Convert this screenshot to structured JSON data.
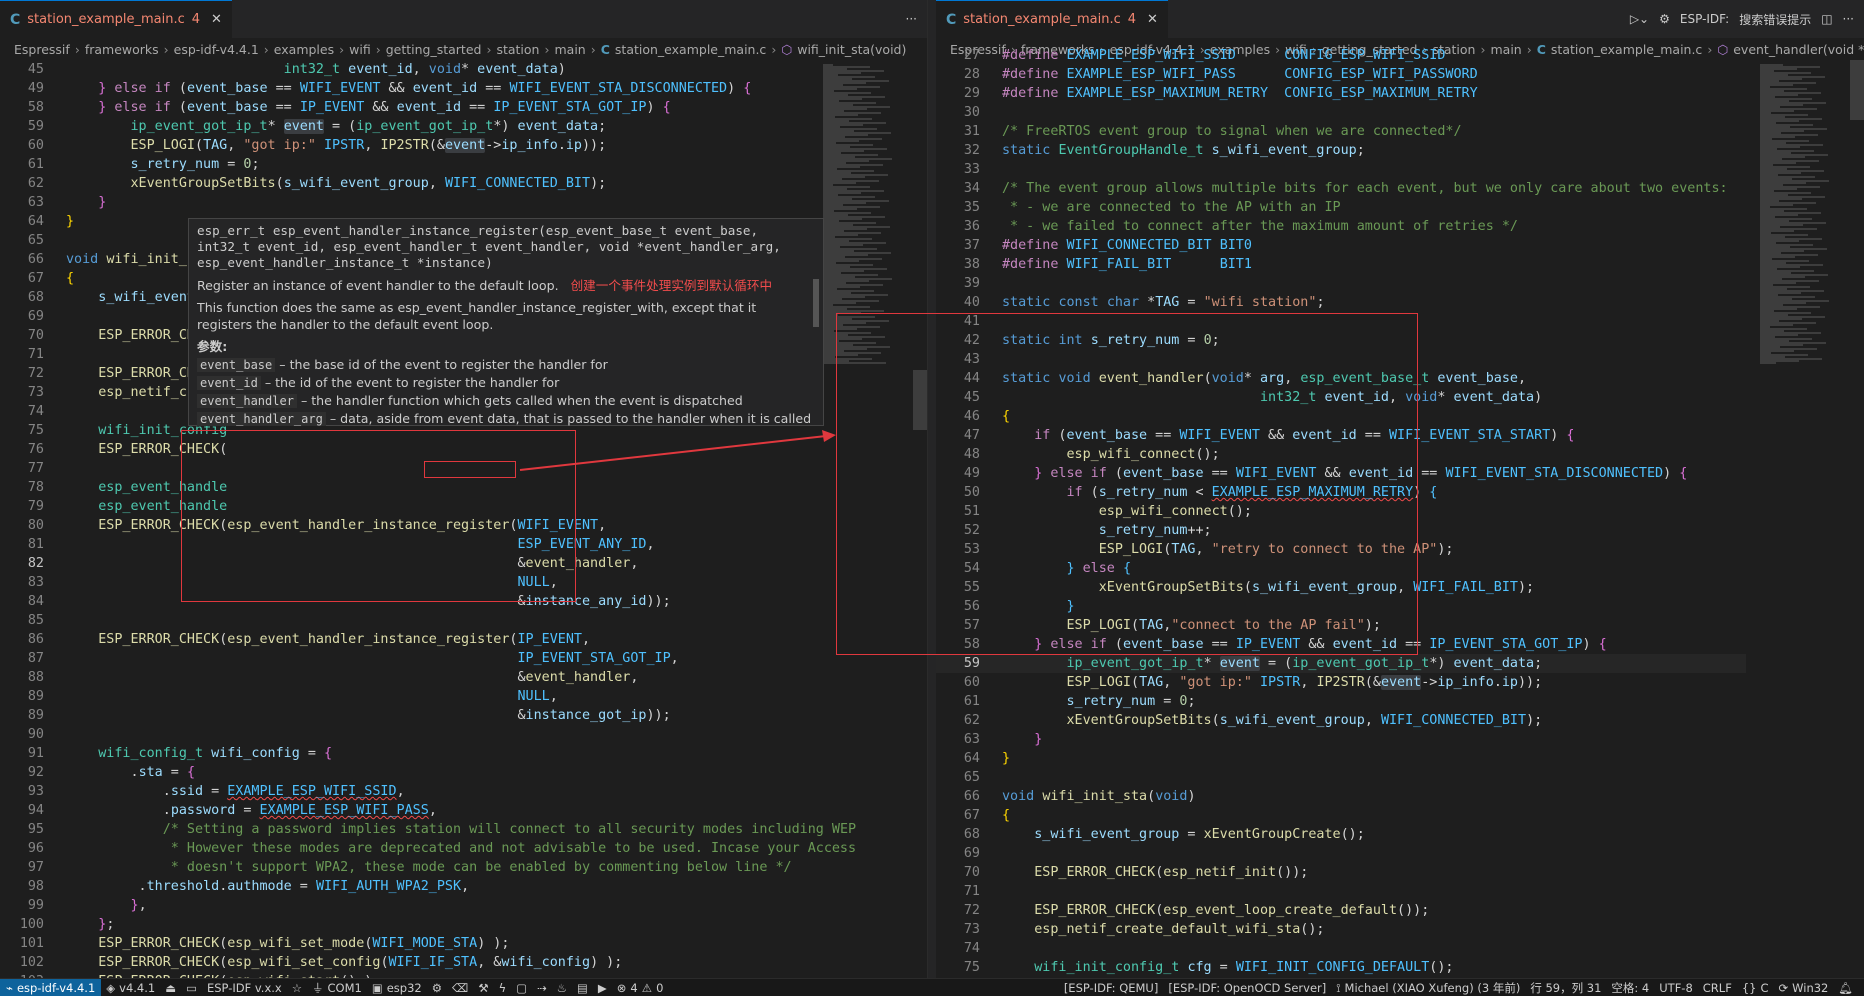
{
  "left": {
    "tab": {
      "name": "station_example_main.c",
      "problems": "4"
    },
    "breadcrumb": [
      "Espressif",
      "frameworks",
      "esp-idf-v4.4.1",
      "examples",
      "wifi",
      "getting_started",
      "station",
      "main",
      "station_example_main.c",
      "wifi_init_sta(void)"
    ],
    "hover": {
      "signature": "esp_err_t esp_event_handler_instance_register(esp_event_base_t event_base, int32_t event_id, esp_event_handler_t event_handler, void *event_handler_arg, esp_event_handler_instance_t *instance)",
      "summary": "Register an instance of event handler to the default loop.",
      "annotation": "创建一个事件处理实例到默认循环中",
      "description": "This function does the same as esp_event_handler_instance_register_with, except that it registers the handler to the default event loop.",
      "params_title": "参数:",
      "params": [
        {
          "name": "event_base",
          "desc": "– the base id of the event to register the handler for"
        },
        {
          "name": "event_id",
          "desc": "– the id of the event to register the handler for"
        },
        {
          "name": "event_handler",
          "desc": "– the handler function which gets called when the event is dispatched"
        },
        {
          "name": "event_handler_arg",
          "desc": "– data, aside from event data, that is passed to the handler when it is called"
        }
      ]
    }
  },
  "right": {
    "tab": {
      "name": "station_example_main.c",
      "problems": "4"
    },
    "actions": {
      "idf_label": "ESP-IDF:",
      "search_label": "搜索错误提示"
    },
    "breadcrumb": [
      "Espressif",
      "frameworks",
      "esp-idf-v4.4.1",
      "examples",
      "wifi",
      "getting_started",
      "station",
      "main",
      "station_example_main.c",
      "event_handler(void *, esp_eve"
    ]
  },
  "statusbar": {
    "remote": "esp-idf-v4.4.1",
    "version": "v4.4.1",
    "idf_label": "ESP-IDF v.x.x",
    "port": "COM1",
    "target": "esp32",
    "problems": "4",
    "warnings": "0",
    "qemu": "[ESP-IDF: QEMU]",
    "openocd": "[ESP-IDF: OpenOCD Server]",
    "author": "Michael (XIAO Xufeng) (3 年前)",
    "position": "行 59，列 31",
    "spaces": "空格: 4",
    "encoding": "UTF-8",
    "eol": "CRLF",
    "language": "C",
    "platform": "Win32"
  },
  "colors": {
    "accent": "#0078d4",
    "annotation": "#e0383e",
    "error": "#f48771"
  }
}
